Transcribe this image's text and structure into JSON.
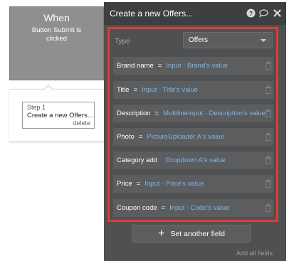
{
  "canvas": {
    "when_title": "When",
    "when_subtitle_line1": "Button Submit is",
    "when_subtitle_line2": "clicked",
    "step_label": "Step 1",
    "step_title": "Create a new Offers...",
    "step_delete": "delete"
  },
  "panel": {
    "title": "Create a new Offers...",
    "icons": [
      "help-icon",
      "comment-icon",
      "close-icon"
    ],
    "type_label": "Type",
    "type_value": "Offers",
    "fields": [
      {
        "name": "Brand name",
        "eq": "=",
        "value": "Input - Brand's value"
      },
      {
        "name": "Title",
        "eq": "=",
        "value": "Input - Title's value"
      },
      {
        "name": "Description",
        "eq": "=",
        "value": "MultilineInput - Description's value"
      },
      {
        "name": "Photo",
        "eq": "=",
        "value": "PictureUploader A's value"
      },
      {
        "name": "Category add",
        "eq": "",
        "value": "Dropdown A's value"
      },
      {
        "name": "Price",
        "eq": "=",
        "value": "Input - Price's value"
      },
      {
        "name": "Coupon code",
        "eq": "=",
        "value": "Input - Code's value"
      }
    ],
    "set_field_label": "Set another field",
    "add_all_label": "Add all fields"
  },
  "colors": {
    "panel_bg": "#4e5052",
    "header_bg": "#3d3f41",
    "field_bg": "#5b5d5f",
    "value_blue": "#7fb6ea",
    "highlight_red": "#e23b33",
    "when_card_bg": "#8f8f8f"
  }
}
